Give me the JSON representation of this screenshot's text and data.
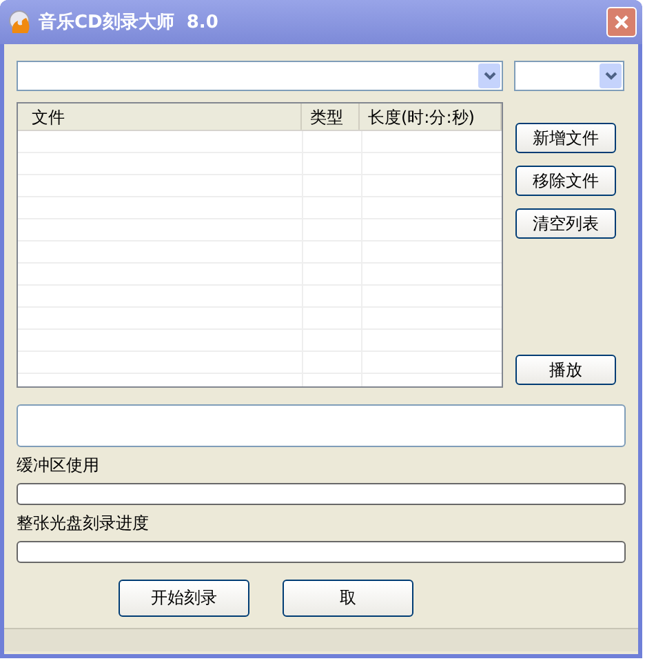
{
  "window": {
    "title": "音乐CD刻录大师  8.0"
  },
  "file_table": {
    "columns": [
      "文件",
      "类型",
      "长度(时:分:秒)"
    ]
  },
  "side_buttons": [
    "新增文件",
    "移除文件",
    "清空列表"
  ],
  "play_button": "播放",
  "buffer": {
    "label": "缓冲区使用",
    "level": 0
  },
  "progress": {
    "label": "整张光盘刻录进度",
    "level": 0
  },
  "buttons": [
    "开始刻录",
    "取"
  ]
}
